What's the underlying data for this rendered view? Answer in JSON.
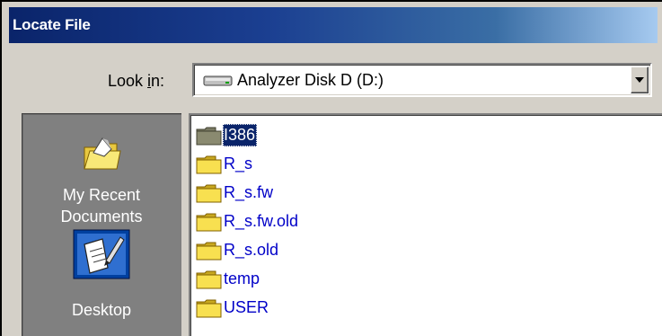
{
  "window": {
    "title": "Locate File"
  },
  "look_in": {
    "label_before": "Look ",
    "label_accel": "i",
    "label_after": "n:",
    "value": "Analyzer Disk D (D:)"
  },
  "places": [
    {
      "label_line1": "My Recent",
      "label_line2": "Documents",
      "icon": "recent-documents-icon"
    },
    {
      "label_line1": "Desktop",
      "label_line2": "",
      "icon": "desktop-icon"
    }
  ],
  "files": [
    {
      "name": "I386",
      "icon": "folder-icon",
      "selected": true
    },
    {
      "name": "R_s",
      "icon": "folder-icon",
      "selected": false
    },
    {
      "name": "R_s.fw",
      "icon": "folder-icon",
      "selected": false
    },
    {
      "name": "R_s.fw.old",
      "icon": "folder-icon",
      "selected": false
    },
    {
      "name": "R_s.old",
      "icon": "folder-icon",
      "selected": false
    },
    {
      "name": "temp",
      "icon": "folder-icon",
      "selected": false
    },
    {
      "name": "USER",
      "icon": "folder-icon",
      "selected": false
    }
  ],
  "colors": {
    "title_bar": "#0a246a",
    "dialog_face": "#d4d0c8",
    "places_bar": "#808080",
    "file_link_text": "#0000c8",
    "selection": "#0a246a",
    "folder_yellow": "#f8e050"
  }
}
